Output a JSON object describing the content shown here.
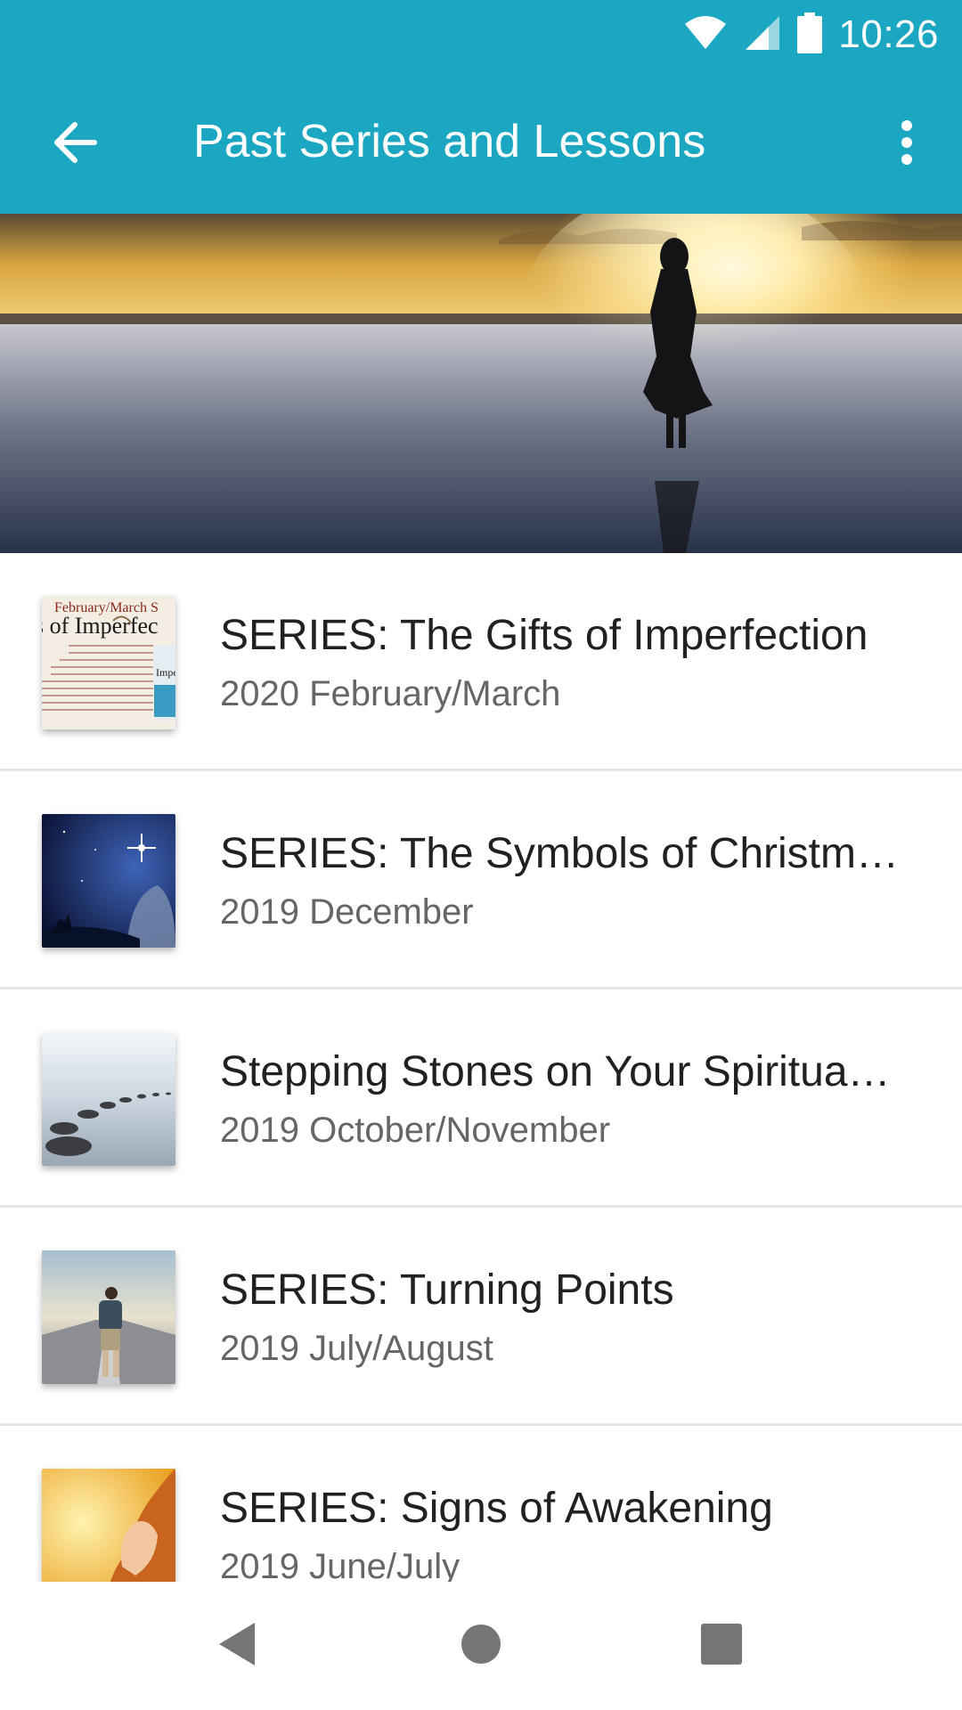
{
  "status_bar": {
    "time": "10:26"
  },
  "app_bar": {
    "title": "Past Series and Lessons"
  },
  "series": [
    {
      "title": "SERIES: The Gifts of Imperfection",
      "subtitle": "2020 February/March",
      "thumb_text": {
        "line1": "February/March S",
        "line2": "s of Imperfec",
        "line3": "Impe"
      }
    },
    {
      "title": "SERIES: The Symbols of Christm…",
      "subtitle": "2019 December"
    },
    {
      "title": "Stepping Stones on Your Spiritua…",
      "subtitle": "2019 October/November"
    },
    {
      "title": "SERIES: Turning Points",
      "subtitle": "2019 July/August"
    },
    {
      "title": "SERIES: Signs of Awakening",
      "subtitle": "2019 June/July"
    }
  ],
  "colors": {
    "primary": "#1ba7c2",
    "title_text": "#212121",
    "subtitle_text": "#666666",
    "divider": "#e6e6e6"
  },
  "icons": {
    "back": "arrow-left-icon",
    "more": "more-vert-icon",
    "wifi": "wifi-icon",
    "signal": "signal-icon",
    "battery": "battery-icon",
    "nav_back": "triangle-back-icon",
    "nav_home": "circle-home-icon",
    "nav_recents": "square-recents-icon"
  }
}
